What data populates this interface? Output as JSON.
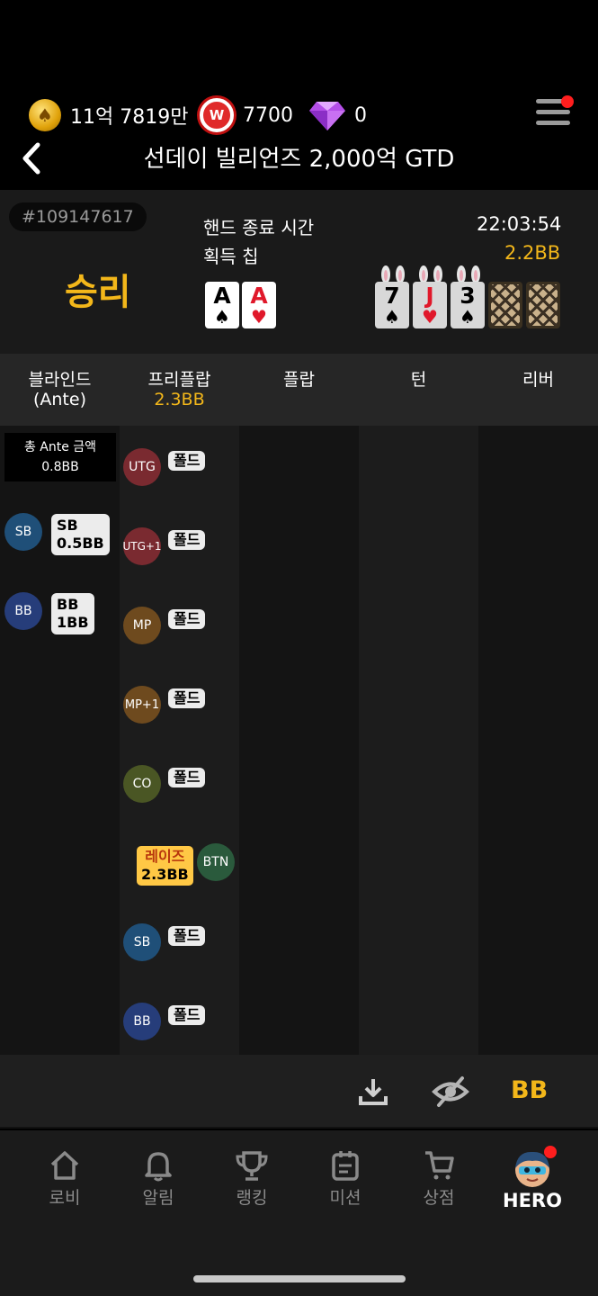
{
  "header": {
    "currencies": [
      {
        "icon": "gold-coin-icon",
        "value": "11억 7819만"
      },
      {
        "icon": "w-token-icon",
        "value": "7700"
      },
      {
        "icon": "diamond-icon",
        "value": "0"
      }
    ],
    "title": "선데이 빌리언즈 2,000억 GTD"
  },
  "hand": {
    "id": "#109147617",
    "result": "승리",
    "end_time_label": "핸드 종료 시간",
    "end_time_value": "22:03:54",
    "chips_label": "획득 칩",
    "chips_value": "2.2BB",
    "hole_cards": [
      {
        "rank": "A",
        "suit": "♠",
        "color": "black"
      },
      {
        "rank": "A",
        "suit": "♥",
        "color": "red"
      }
    ],
    "board": [
      {
        "rank": "7",
        "suit": "♠",
        "color": "black"
      },
      {
        "rank": "J",
        "suit": "♥",
        "color": "red"
      },
      {
        "rank": "3",
        "suit": "♠",
        "color": "black"
      },
      {
        "rank": "",
        "suit": "",
        "color": "back"
      },
      {
        "rank": "",
        "suit": "",
        "color": "back"
      }
    ]
  },
  "streets": {
    "blinds": "블라인드",
    "blinds_sub": "(Ante)",
    "preflop": "프리플랍",
    "preflop_pot": "2.3BB",
    "flop": "플랍",
    "turn": "턴",
    "river": "리버"
  },
  "blinds_col": {
    "ante_label": "총 Ante 금액",
    "ante_value": "0.8BB",
    "sb": {
      "pos": "SB",
      "label": "SB",
      "amount": "0.5BB"
    },
    "bb": {
      "pos": "BB",
      "label": "BB",
      "amount": "1BB"
    }
  },
  "preflop_actions": [
    {
      "pos": "UTG",
      "action": "폴드",
      "amount": ""
    },
    {
      "pos": "UTG+1",
      "action": "폴드",
      "amount": ""
    },
    {
      "pos": "MP",
      "action": "폴드",
      "amount": ""
    },
    {
      "pos": "MP+1",
      "action": "폴드",
      "amount": ""
    },
    {
      "pos": "CO",
      "action": "폴드",
      "amount": ""
    },
    {
      "pos": "BTN",
      "action": "레이즈",
      "amount": "2.3BB"
    },
    {
      "pos": "SB",
      "action": "폴드",
      "amount": ""
    },
    {
      "pos": "BB",
      "action": "폴드",
      "amount": ""
    }
  ],
  "tools": {
    "unit_toggle": "BB"
  },
  "nav": [
    {
      "label": "로비",
      "icon": "home-icon"
    },
    {
      "label": "알림",
      "icon": "bell-icon"
    },
    {
      "label": "랭킹",
      "icon": "trophy-icon"
    },
    {
      "label": "미션",
      "icon": "mission-icon"
    },
    {
      "label": "상점",
      "icon": "cart-icon"
    },
    {
      "label": "HERO",
      "icon": "avatar"
    }
  ],
  "colors": {
    "accent": "#f3b71a",
    "background": "#000000",
    "notification": "#ff1e1e"
  }
}
